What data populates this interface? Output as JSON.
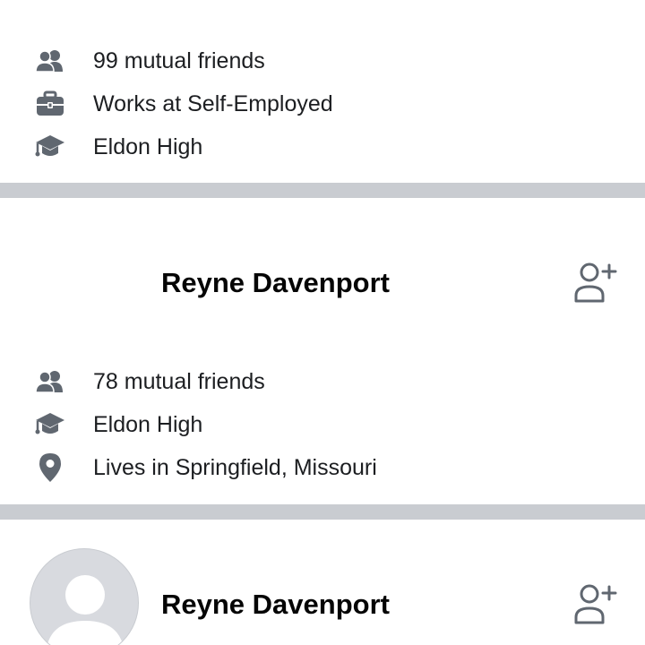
{
  "cards": [
    {
      "details": [
        {
          "icon": "mutual-friends-icon",
          "text": "99 mutual friends"
        },
        {
          "icon": "briefcase-icon",
          "text": "Works at Self-Employed"
        },
        {
          "icon": "graduation-cap-icon",
          "text": "Eldon High"
        }
      ]
    },
    {
      "name": "Reyne Davenport",
      "details": [
        {
          "icon": "mutual-friends-icon",
          "text": "78 mutual friends"
        },
        {
          "icon": "graduation-cap-icon",
          "text": "Eldon High"
        },
        {
          "icon": "location-pin-icon",
          "text": "Lives in Springfield, Missouri"
        }
      ]
    },
    {
      "name": "Reyne Davenport"
    }
  ],
  "colors": {
    "icon": "#606770",
    "text": "#1c1e21",
    "name": "#050505",
    "divider": "#c9ccd1",
    "avatar_bg": "#d8dadf",
    "avatar_silhouette": "#ffffff"
  }
}
